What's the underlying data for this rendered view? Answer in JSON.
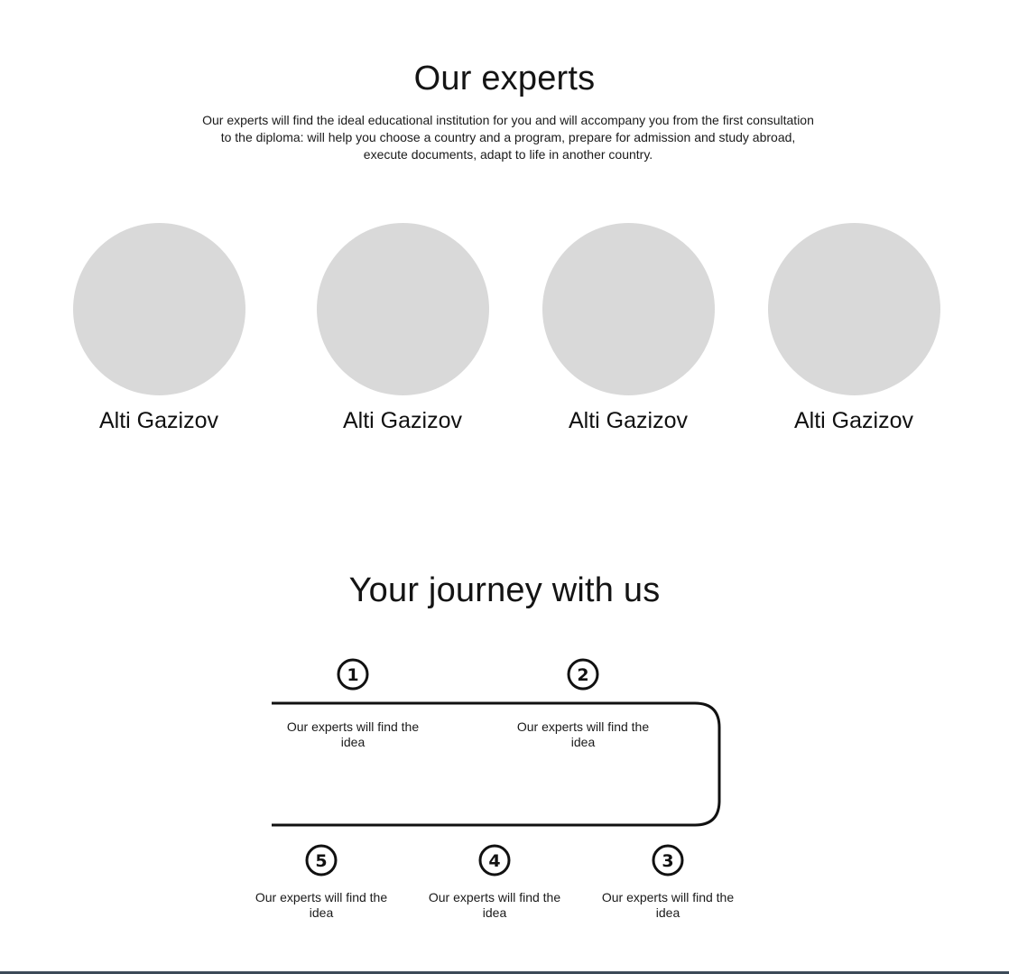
{
  "experts_section": {
    "title": "Our experts",
    "intro_lines": [
      "Our experts will find the ideal educational institution for you and will accompany you from the first consultation",
      "to the diploma: will help you choose a country and a program, prepare for admission and study abroad,",
      "execute documents, adapt to life in another country."
    ],
    "experts": [
      {
        "name": "Alti Gazizov"
      },
      {
        "name": "Alti Gazizov"
      },
      {
        "name": "Alti Gazizov"
      },
      {
        "name": "Alti Gazizov"
      }
    ],
    "avatar_color": "#d9d9d9"
  },
  "journey_section": {
    "title": "Your journey with us",
    "steps": [
      {
        "number": "1",
        "text_line1": "Our experts will find the",
        "text_line2": "idea"
      },
      {
        "number": "2",
        "text_line1": "Our experts will find the",
        "text_line2": "idea"
      },
      {
        "number": "3",
        "text_line1": "Our experts will find the",
        "text_line2": "idea"
      },
      {
        "number": "4",
        "text_line1": "Our experts will find the",
        "text_line2": "idea"
      },
      {
        "number": "5",
        "text_line1": "Our experts will find the",
        "text_line2": "idea"
      }
    ]
  },
  "colors": {
    "track": "#111111",
    "footer_bar": "#3c4a58"
  }
}
